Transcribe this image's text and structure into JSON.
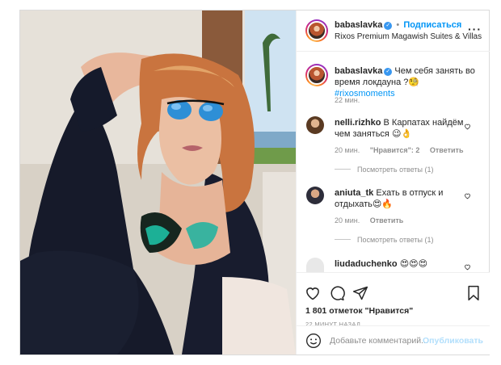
{
  "post": {
    "author": {
      "username": "babaslavka",
      "follow_label": "Подписаться",
      "separator": "•",
      "location": "Rixos Premium Magawish Suites & Villas",
      "verified_icon": "verified-badge-icon"
    },
    "more_icon": "more-dots-icon",
    "caption": {
      "username": "babaslavka",
      "text": "Чем себя занять во время локдауна ?",
      "emoji": "🧐",
      "hashtag": "#rixosmoments",
      "time": "22 мин."
    },
    "comments": [
      {
        "username": "nelli.rizhko",
        "text": "В Карпатах найдём чем заняться",
        "emoji": "😉👌",
        "time": "20 мин.",
        "likes": "\"Нравится\": 2",
        "reply": "Ответить",
        "view_replies": "Посмотреть ответы (1)"
      },
      {
        "username": "aniuta_tk",
        "text": "Ехать в отпуск и отдыхать",
        "emoji": "😍🔥",
        "time": "20 мин.",
        "reply": "Ответить",
        "view_replies": "Посмотреть ответы (1)"
      },
      {
        "username": "liudaduchenko",
        "emoji": "😍😍😍"
      }
    ],
    "likes_text": "1 801 отметок \"Нравится\"",
    "timestamp": "22 МИНУТ НАЗАД",
    "add_comment_placeholder": "Добавьте комментарий...",
    "publish_label": "Опубликовать"
  },
  "colors": {
    "link_blue": "#0095f6",
    "muted": "#8e8e8e",
    "border": "#dbdbdb",
    "text": "#262626"
  }
}
